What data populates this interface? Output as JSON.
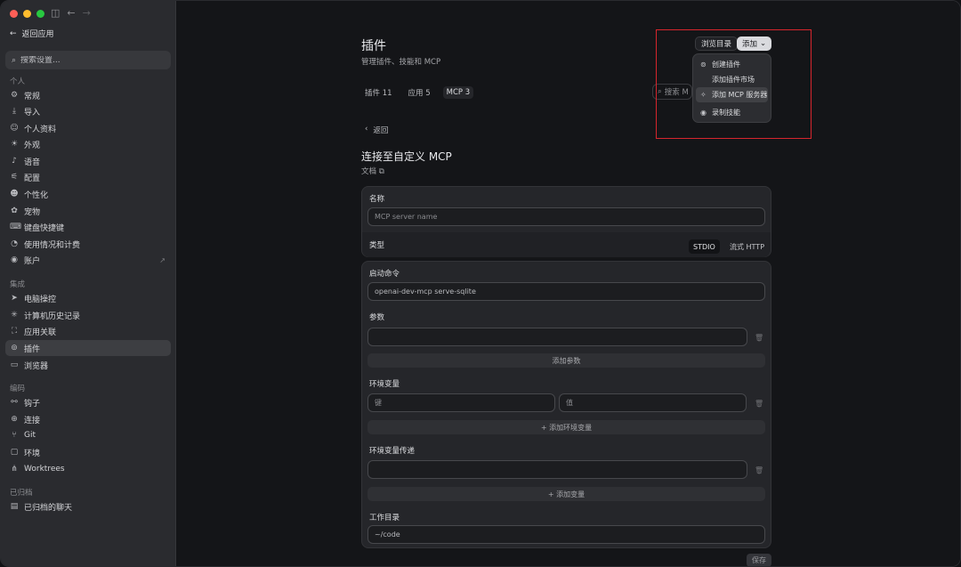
{
  "sidebar": {
    "back_label": "返回应用",
    "search_placeholder": "搜索设置...",
    "sections": [
      {
        "label": "个人"
      },
      {
        "label": "集成"
      },
      {
        "label": "编码"
      },
      {
        "label": "已归档"
      }
    ],
    "personal": [
      {
        "label": "常规",
        "icon": "gear-icon"
      },
      {
        "label": "导入",
        "icon": "import-icon"
      },
      {
        "label": "个人资料",
        "icon": "user-icon"
      },
      {
        "label": "外观",
        "icon": "sun-icon"
      },
      {
        "label": "语音",
        "icon": "mic-icon"
      },
      {
        "label": "配置",
        "icon": "sliders-icon"
      },
      {
        "label": "个性化",
        "icon": "smile-icon"
      },
      {
        "label": "宠物",
        "icon": "pet-icon"
      },
      {
        "label": "键盘快捷键",
        "icon": "keyboard-icon"
      },
      {
        "label": "使用情况和计费",
        "icon": "chart-icon"
      },
      {
        "label": "账户",
        "icon": "account-icon"
      }
    ],
    "integrations": [
      {
        "label": "电脑操控",
        "icon": "cursor-icon"
      },
      {
        "label": "计算机历史记录",
        "icon": "history-icon"
      },
      {
        "label": "应用关联",
        "icon": "link-icon"
      },
      {
        "label": "插件",
        "icon": "plugin-icon"
      },
      {
        "label": "浏览器",
        "icon": "browser-icon"
      }
    ],
    "coding": [
      {
        "label": "钩子",
        "icon": "hook-icon"
      },
      {
        "label": "连接",
        "icon": "globe-icon"
      },
      {
        "label": "Git",
        "icon": "git-icon"
      },
      {
        "label": "环境",
        "icon": "chat-icon"
      },
      {
        "label": "Worktrees",
        "icon": "tree-icon"
      }
    ],
    "archived": [
      {
        "label": "已归档的聊天",
        "icon": "archive-icon"
      }
    ]
  },
  "main": {
    "title": "插件",
    "subtitle": "管理插件、技能和 MCP",
    "tabs": [
      {
        "label": "插件 11"
      },
      {
        "label": "应用 5"
      },
      {
        "label": "MCP 3"
      }
    ],
    "browse_label": "浏览目录",
    "add_label": "添加",
    "search_placeholder": "搜索 M",
    "dropdown": [
      {
        "label": "创建插件",
        "icon": "plugin-icon"
      },
      {
        "label": "添加插件市场",
        "icon": ""
      },
      {
        "label": "添加 MCP 服务器",
        "icon": "mcp-icon"
      },
      {
        "label": "录制技能",
        "icon": "record-icon"
      }
    ],
    "back_label": "返回",
    "form_title": "连接至自定义 MCP",
    "doc_label": "文档"
  },
  "form": {
    "name_label": "名称",
    "name_placeholder": "MCP server name",
    "type_label": "类型",
    "type_options": [
      "STDIO",
      "流式 HTTP"
    ],
    "command_label": "启动命令",
    "command_value": "openai-dev-mcp serve-sqlite",
    "args_label": "参数",
    "add_arg_label": "添加参数",
    "env_label": "环境变量",
    "env_key_placeholder": "键",
    "env_value_placeholder": "值",
    "add_env_label": "+ 添加环境变量",
    "env_pass_label": "环境变量传递",
    "add_var_label": "+ 添加变量",
    "cwd_label": "工作目录",
    "cwd_value": "~/code",
    "save_label": "保存"
  }
}
